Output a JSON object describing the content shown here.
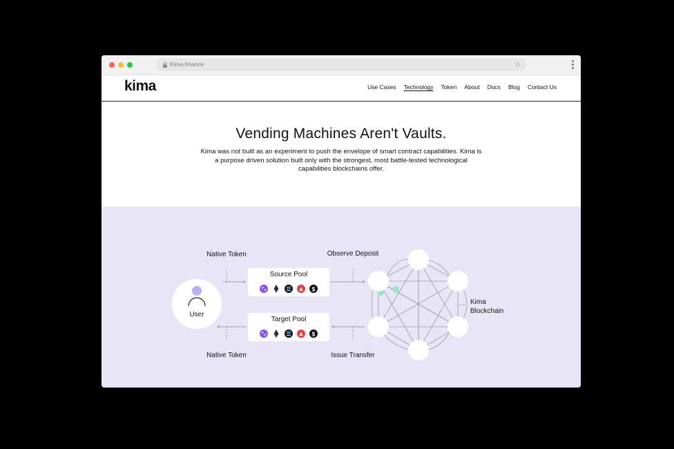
{
  "browser": {
    "url": "Kima.finance",
    "icons": [
      "lock-icon",
      "star-icon",
      "menu-kebab-icon"
    ]
  },
  "nav": {
    "logo": "kima",
    "links": [
      {
        "label": "Use Cases",
        "active": false
      },
      {
        "label": "Technology",
        "active": true
      },
      {
        "label": "Token",
        "active": false
      },
      {
        "label": "About",
        "active": false
      },
      {
        "label": "Docs",
        "active": false
      },
      {
        "label": "Blog",
        "active": false
      },
      {
        "label": "Contact Us",
        "active": false
      }
    ]
  },
  "hero": {
    "title": "Vending Machines Aren't Vaults.",
    "body": "Kima was not built as an experiment to push the envelope of smart contract capabilities. Kima is a purpose driven solution built only with the strongest, most battle-tested technological capabilities blockchains offer."
  },
  "diagram": {
    "user_label": "User",
    "native_token_top": "Native Token",
    "native_token_bottom": "Native Token",
    "source_pool": "Source Pool",
    "target_pool": "Target Pool",
    "observe_deposit": "Observe Deposit",
    "issue_transfer": "Issue Transfer",
    "kima_label_1": "Kima",
    "kima_label_2": "Blockchain",
    "token_icons": [
      "chainlink-icon",
      "ethereum-icon",
      "solana-icon",
      "avalanche-icon",
      "dollar-coin-icon"
    ]
  },
  "colors": {
    "section_bg": "#e8e6f6",
    "accent_purple": "#8a54f0",
    "node_green": "#9de3c5"
  }
}
